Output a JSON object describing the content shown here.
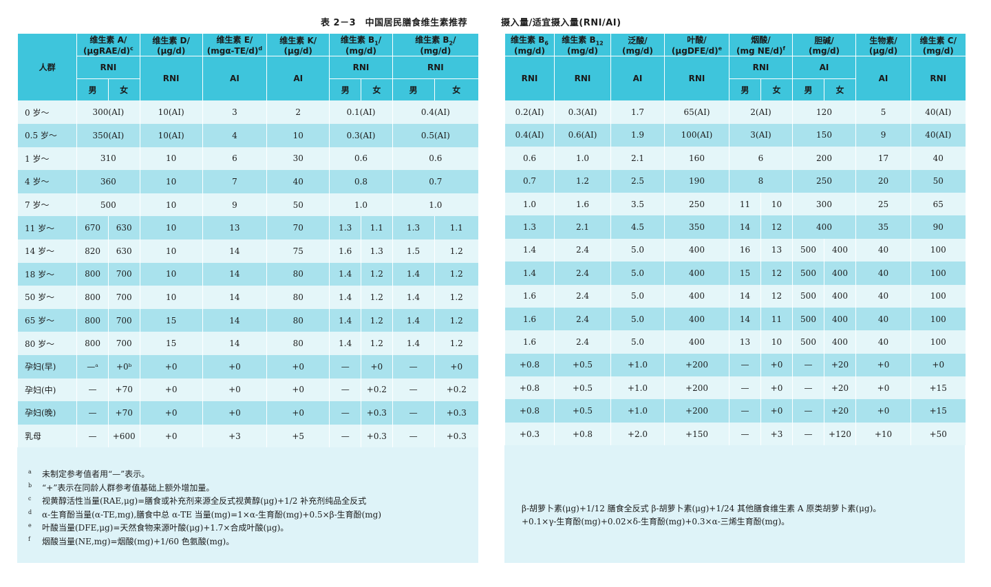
{
  "title_left": "表 2－3　中国居民膳食维生素推荐",
  "title_right": "摄入量/适宜摄入量(RNI/AI)",
  "left_headers": {
    "group": "人群",
    "vitA": [
      "维生素 A/",
      "(μgRAE/d)"
    ],
    "vitA_sup": "c",
    "vitD": [
      "维生素 D/",
      "(μg/d)"
    ],
    "vitE": [
      "维生素 E/",
      "(mgα-TE/d)"
    ],
    "vitE_sup": "d",
    "vitK": [
      "维生素 K/",
      "(μg/d)"
    ],
    "vitB1": [
      "维生素 B",
      "1",
      "/",
      "(mg/d)"
    ],
    "vitB2": [
      "维生素 B",
      "2",
      "/",
      "(mg/d)"
    ],
    "RNI": "RNI",
    "AI": "AI",
    "male": "男",
    "female": "女"
  },
  "right_headers": {
    "vitB6": [
      "维生素 B",
      "6",
      "(mg/d)"
    ],
    "vitB12": [
      "维生素 B",
      "12",
      "(mg/d)"
    ],
    "panto": [
      "泛酸/",
      "(mg/d)"
    ],
    "folate": [
      "叶酸/",
      "(μgDFE/d)"
    ],
    "folate_sup": "e",
    "niacin": [
      "烟酸/",
      "(mg NE/d)"
    ],
    "niacin_sup": "f",
    "choline": [
      "胆碱/",
      "(mg/d)"
    ],
    "biotin": [
      "生物素/",
      "(μg/d)"
    ],
    "vitC": [
      "维生素 C/",
      "(mg/d)"
    ],
    "RNI": "RNI",
    "AI": "AI",
    "male": "男",
    "female": "女"
  },
  "left_rows": [
    {
      "group": "0 岁～",
      "a": "300(AI)",
      "d": "10(AI)",
      "e": "3",
      "k": "2",
      "b1": "0.1(AI)",
      "b2": "0.4(AI)"
    },
    {
      "group": "0.5 岁～",
      "a": "350(AI)",
      "d": "10(AI)",
      "e": "4",
      "k": "10",
      "b1": "0.3(AI)",
      "b2": "0.5(AI)"
    },
    {
      "group": "1 岁～",
      "a": "310",
      "d": "10",
      "e": "6",
      "k": "30",
      "b1": "0.6",
      "b2": "0.6"
    },
    {
      "group": "4 岁～",
      "a": "360",
      "d": "10",
      "e": "7",
      "k": "40",
      "b1": "0.8",
      "b2": "0.7"
    },
    {
      "group": "7 岁～",
      "a": "500",
      "d": "10",
      "e": "9",
      "k": "50",
      "b1": "1.0",
      "b2": "1.0"
    },
    {
      "group": "11 岁～",
      "am": "670",
      "af": "630",
      "d": "10",
      "e": "13",
      "k": "70",
      "b1m": "1.3",
      "b1f": "1.1",
      "b2m": "1.3",
      "b2f": "1.1"
    },
    {
      "group": "14 岁～",
      "am": "820",
      "af": "630",
      "d": "10",
      "e": "14",
      "k": "75",
      "b1m": "1.6",
      "b1f": "1.3",
      "b2m": "1.5",
      "b2f": "1.2"
    },
    {
      "group": "18 岁～",
      "am": "800",
      "af": "700",
      "d": "10",
      "e": "14",
      "k": "80",
      "b1m": "1.4",
      "b1f": "1.2",
      "b2m": "1.4",
      "b2f": "1.2"
    },
    {
      "group": "50 岁～",
      "am": "800",
      "af": "700",
      "d": "10",
      "e": "14",
      "k": "80",
      "b1m": "1.4",
      "b1f": "1.2",
      "b2m": "1.4",
      "b2f": "1.2"
    },
    {
      "group": "65 岁～",
      "am": "800",
      "af": "700",
      "d": "15",
      "e": "14",
      "k": "80",
      "b1m": "1.4",
      "b1f": "1.2",
      "b2m": "1.4",
      "b2f": "1.2"
    },
    {
      "group": "80 岁～",
      "am": "800",
      "af": "700",
      "d": "15",
      "e": "14",
      "k": "80",
      "b1m": "1.4",
      "b1f": "1.2",
      "b2m": "1.4",
      "b2f": "1.2"
    },
    {
      "group": "孕妇(早)",
      "am": "—ᵃ",
      "af": "+0ᵇ",
      "d": "+0",
      "e": "+0",
      "k": "+0",
      "b1m": "—",
      "b1f": "+0",
      "b2m": "—",
      "b2f": "+0"
    },
    {
      "group": "孕妇(中)",
      "am": "—",
      "af": "+70",
      "d": "+0",
      "e": "+0",
      "k": "+0",
      "b1m": "—",
      "b1f": "+0.2",
      "b2m": "—",
      "b2f": "+0.2"
    },
    {
      "group": "孕妇(晚)",
      "am": "—",
      "af": "+70",
      "d": "+0",
      "e": "+0",
      "k": "+0",
      "b1m": "—",
      "b1f": "+0.3",
      "b2m": "—",
      "b2f": "+0.3"
    },
    {
      "group": "乳母",
      "am": "—",
      "af": "+600",
      "d": "+0",
      "e": "+3",
      "k": "+5",
      "b1m": "—",
      "b1f": "+0.3",
      "b2m": "—",
      "b2f": "+0.3"
    }
  ],
  "right_rows": [
    {
      "b6": "0.2(AI)",
      "b12": "0.3(AI)",
      "p": "1.7",
      "f": "65(AI)",
      "n": "2(AI)",
      "c": "120",
      "bio": "5",
      "vc": "40(AI)"
    },
    {
      "b6": "0.4(AI)",
      "b12": "0.6(AI)",
      "p": "1.9",
      "f": "100(AI)",
      "n": "3(AI)",
      "c": "150",
      "bio": "9",
      "vc": "40(AI)"
    },
    {
      "b6": "0.6",
      "b12": "1.0",
      "p": "2.1",
      "f": "160",
      "n": "6",
      "c": "200",
      "bio": "17",
      "vc": "40"
    },
    {
      "b6": "0.7",
      "b12": "1.2",
      "p": "2.5",
      "f": "190",
      "n": "8",
      "c": "250",
      "bio": "20",
      "vc": "50"
    },
    {
      "b6": "1.0",
      "b12": "1.6",
      "p": "3.5",
      "f": "250",
      "nm": "11",
      "nf": "10",
      "c": "300",
      "bio": "25",
      "vc": "65"
    },
    {
      "b6": "1.3",
      "b12": "2.1",
      "p": "4.5",
      "f": "350",
      "nm": "14",
      "nf": "12",
      "c": "400",
      "bio": "35",
      "vc": "90"
    },
    {
      "b6": "1.4",
      "b12": "2.4",
      "p": "5.0",
      "f": "400",
      "nm": "16",
      "nf": "13",
      "cm": "500",
      "cf": "400",
      "bio": "40",
      "vc": "100"
    },
    {
      "b6": "1.4",
      "b12": "2.4",
      "p": "5.0",
      "f": "400",
      "nm": "15",
      "nf": "12",
      "cm": "500",
      "cf": "400",
      "bio": "40",
      "vc": "100"
    },
    {
      "b6": "1.6",
      "b12": "2.4",
      "p": "5.0",
      "f": "400",
      "nm": "14",
      "nf": "12",
      "cm": "500",
      "cf": "400",
      "bio": "40",
      "vc": "100"
    },
    {
      "b6": "1.6",
      "b12": "2.4",
      "p": "5.0",
      "f": "400",
      "nm": "14",
      "nf": "11",
      "cm": "500",
      "cf": "400",
      "bio": "40",
      "vc": "100"
    },
    {
      "b6": "1.6",
      "b12": "2.4",
      "p": "5.0",
      "f": "400",
      "nm": "13",
      "nf": "10",
      "cm": "500",
      "cf": "400",
      "bio": "40",
      "vc": "100"
    },
    {
      "b6": "+0.8",
      "b12": "+0.5",
      "p": "+1.0",
      "f": "+200",
      "nm": "—",
      "nf": "+0",
      "cm": "—",
      "cf": "+20",
      "bio": "+0",
      "vc": "+0"
    },
    {
      "b6": "+0.8",
      "b12": "+0.5",
      "p": "+1.0",
      "f": "+200",
      "nm": "—",
      "nf": "+0",
      "cm": "—",
      "cf": "+20",
      "bio": "+0",
      "vc": "+15"
    },
    {
      "b6": "+0.8",
      "b12": "+0.5",
      "p": "+1.0",
      "f": "+200",
      "nm": "—",
      "nf": "+0",
      "cm": "—",
      "cf": "+20",
      "bio": "+0",
      "vc": "+15"
    },
    {
      "b6": "+0.3",
      "b12": "+0.8",
      "p": "+2.0",
      "f": "+150",
      "nm": "—",
      "nf": "+3",
      "cm": "—",
      "cf": "+120",
      "bio": "+10",
      "vc": "+50"
    }
  ],
  "notes": [
    {
      "mark": "a",
      "text": "未制定参考值者用“—”表示。"
    },
    {
      "mark": "b",
      "text": "“+”表示在同龄人群参考值基础上额外增加量。"
    },
    {
      "mark": "c",
      "text": "视黄醇活性当量(RAE,μg)=膳食或补充剂来源全反式视黄醇(μg)+1/2 补充剂纯品全反式"
    },
    {
      "mark": "d",
      "text": "α-生育酚当量(α-TE,mg),膳食中总 α-TE 当量(mg)=1×α-生育酚(mg)+0.5×β-生育酚(mg)"
    },
    {
      "mark": "e",
      "text": "叶酸当量(DFE,μg)=天然食物来源叶酸(μg)+1.7×合成叶酸(μg)。"
    },
    {
      "mark": "f",
      "text": "烟酸当量(NE,mg)=烟酸(mg)+1/60 色氨酸(mg)。"
    }
  ],
  "notes_cont": [
    "β-胡萝卜素(μg)+1/12 膳食全反式 β-胡萝卜素(μg)+1/24 其他膳食维生素 A 原类胡萝卜素(μg)。",
    "+0.1×γ-生育酚(mg)+0.02×δ-生育酚(mg)+0.3×α-三烯生育酚(mg)。"
  ]
}
